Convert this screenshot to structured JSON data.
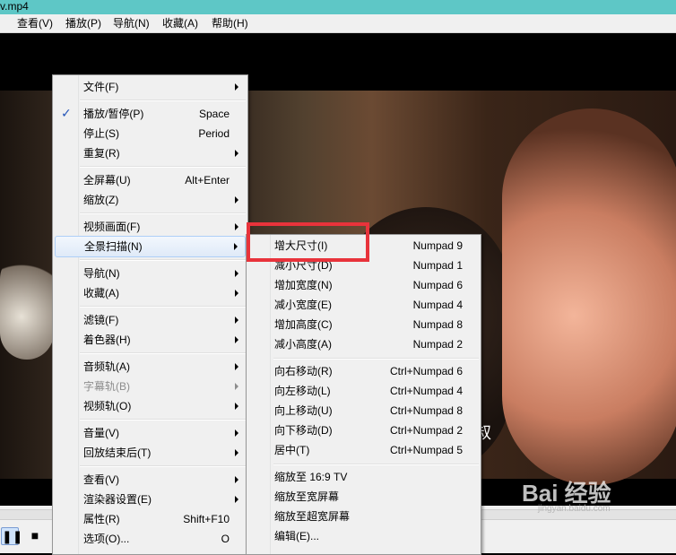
{
  "window": {
    "title": "v.mp4"
  },
  "menubar": [
    {
      "label": "查看(V)"
    },
    {
      "label": "播放(P)"
    },
    {
      "label": "导航(N)"
    },
    {
      "label": "收藏(A)"
    },
    {
      "label": "帮助(H)"
    }
  ],
  "video": {
    "subtitle": "叔"
  },
  "main_menu": {
    "items": [
      {
        "label": "文件(F)",
        "shortcut": "",
        "submenu": true
      },
      {
        "label": "播放/暂停(P)",
        "shortcut": "Space",
        "checked": true
      },
      {
        "label": "停止(S)",
        "shortcut": "Period"
      },
      {
        "label": "重复(R)",
        "shortcut": "",
        "submenu": true
      },
      {
        "label": "全屏幕(U)",
        "shortcut": "Alt+Enter"
      },
      {
        "label": "缩放(Z)",
        "shortcut": "",
        "submenu": true
      },
      {
        "label": "视频画面(F)",
        "shortcut": "",
        "submenu": true
      },
      {
        "label": "全景扫描(N)",
        "shortcut": "",
        "submenu": true,
        "highlighted": true
      },
      {
        "label": "导航(N)",
        "shortcut": "",
        "submenu": true
      },
      {
        "label": "收藏(A)",
        "shortcut": "",
        "submenu": true
      },
      {
        "label": "滤镜(F)",
        "shortcut": "",
        "submenu": true
      },
      {
        "label": "着色器(H)",
        "shortcut": "",
        "submenu": true
      },
      {
        "label": "音频轨(A)",
        "shortcut": "",
        "submenu": true
      },
      {
        "label": "字幕轨(B)",
        "shortcut": "",
        "submenu": true,
        "disabled": true
      },
      {
        "label": "视频轨(O)",
        "shortcut": "",
        "submenu": true
      },
      {
        "label": "音量(V)",
        "shortcut": "",
        "submenu": true
      },
      {
        "label": "回放结束后(T)",
        "shortcut": "",
        "submenu": true
      },
      {
        "label": "查看(V)",
        "shortcut": "",
        "submenu": true
      },
      {
        "label": "渲染器设置(E)",
        "shortcut": "",
        "submenu": true
      },
      {
        "label": "属性(R)",
        "shortcut": "Shift+F10"
      },
      {
        "label": "选项(O)...",
        "shortcut": "O"
      }
    ]
  },
  "pan_scan_menu": {
    "items": [
      {
        "label": "增大尺寸(I)",
        "shortcut": "Numpad 9"
      },
      {
        "label": "减小尺寸(D)",
        "shortcut": "Numpad 1"
      },
      {
        "label": "增加宽度(N)",
        "shortcut": "Numpad 6"
      },
      {
        "label": "减小宽度(E)",
        "shortcut": "Numpad 4"
      },
      {
        "label": "增加高度(C)",
        "shortcut": "Numpad 8"
      },
      {
        "label": "减小高度(A)",
        "shortcut": "Numpad 2"
      },
      {
        "label": "向右移动(R)",
        "shortcut": "Ctrl+Numpad 6"
      },
      {
        "label": "向左移动(L)",
        "shortcut": "Ctrl+Numpad 4"
      },
      {
        "label": "向上移动(U)",
        "shortcut": "Ctrl+Numpad 8"
      },
      {
        "label": "向下移动(D)",
        "shortcut": "Ctrl+Numpad 2"
      },
      {
        "label": "居中(T)",
        "shortcut": "Ctrl+Numpad 5"
      },
      {
        "label": "缩放至 16:9 TV",
        "shortcut": ""
      },
      {
        "label": "缩放至宽屏幕",
        "shortcut": ""
      },
      {
        "label": "缩放至超宽屏幕",
        "shortcut": ""
      },
      {
        "label": "编辑(E)...",
        "shortcut": ""
      }
    ]
  },
  "controls": {
    "pause_icon": "pause-icon",
    "stop_icon": "stop-icon"
  },
  "watermark": {
    "brand": "Bai 经验",
    "url": "jingyan.baidu.com"
  },
  "colors": {
    "highlight_box": "#e8333b",
    "menu_bg": "#f0f0f0",
    "title_bg": "#5ec7c6"
  }
}
